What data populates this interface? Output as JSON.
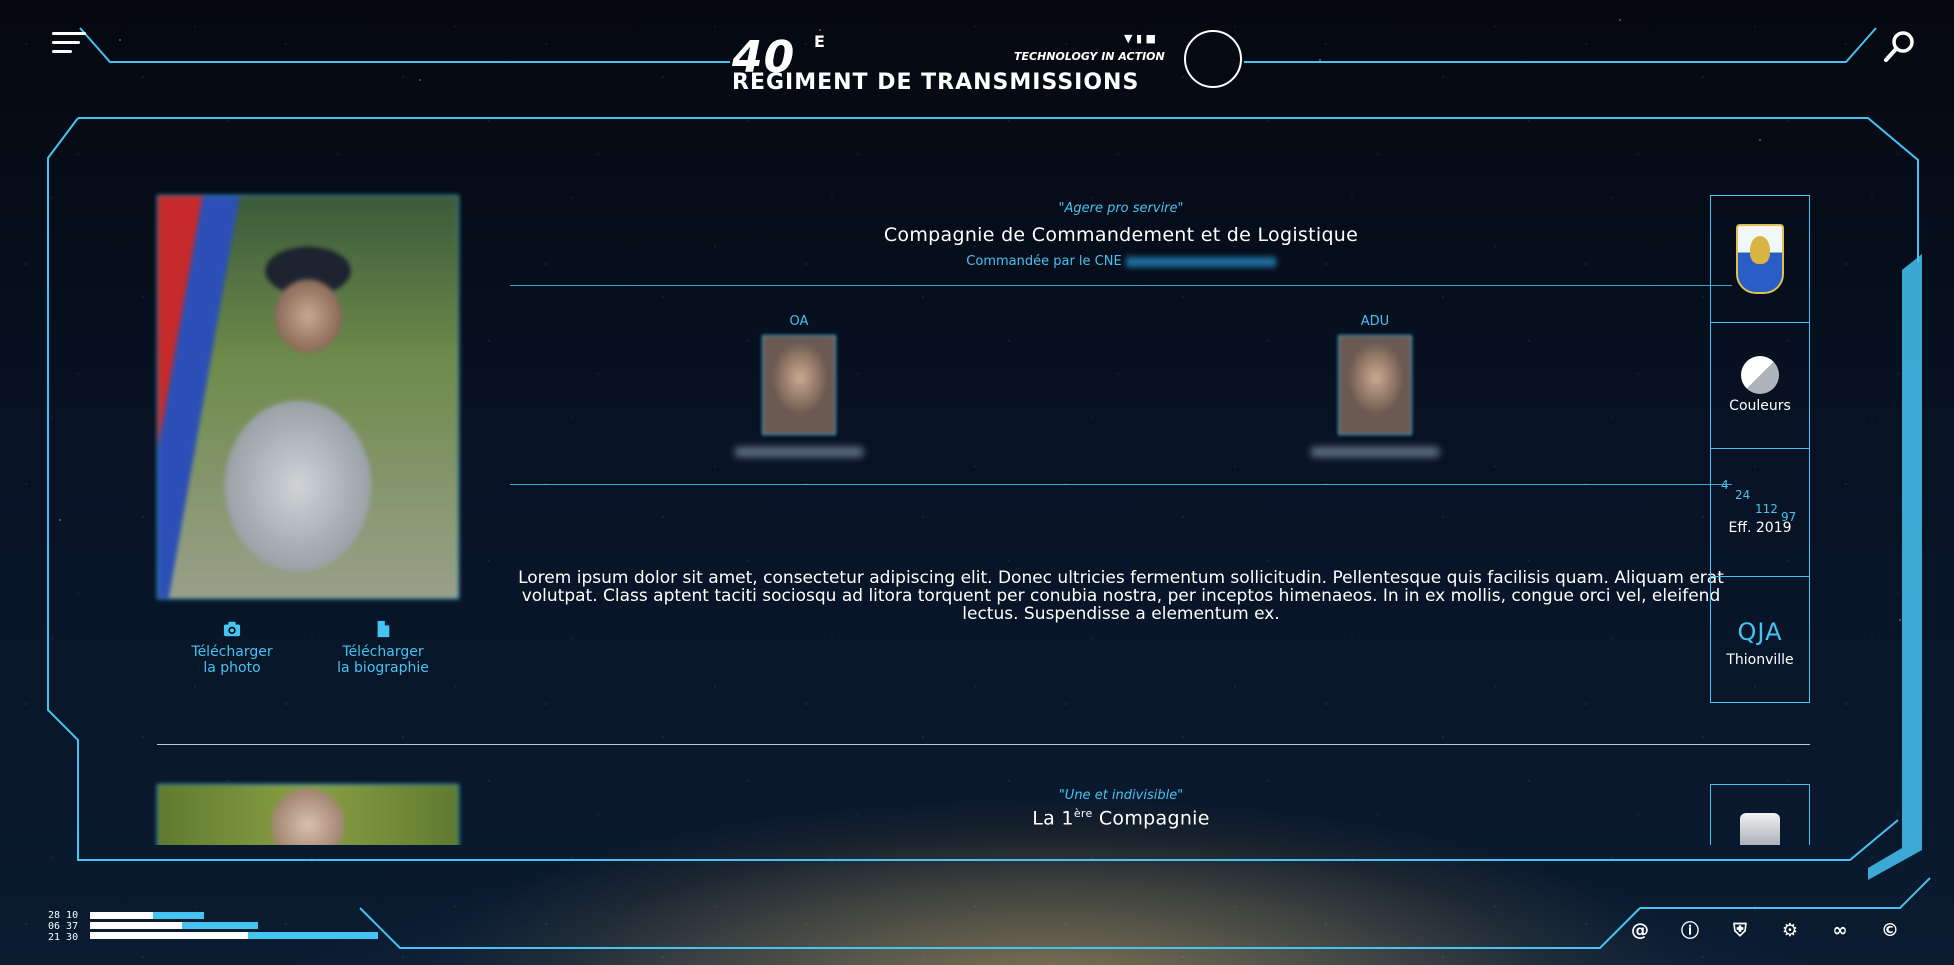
{
  "header": {
    "logo_number": "40",
    "logo_sup": "E",
    "logo_title": "REGIMENT DE TRANSMISSIONS",
    "logo_tagline": "TECHNOLOGY IN ACTION",
    "menu_icon": "menu-icon",
    "search_icon": "search-icon"
  },
  "card1": {
    "motto": "\"Agere pro servire\"",
    "title": "Compagnie de Commandement et de Logistique",
    "commanded_by": "Commandée par le CNE",
    "people": [
      {
        "role": "OA"
      },
      {
        "role": "ADU"
      }
    ],
    "description": "Lorem ipsum dolor sit amet, consectetur adipiscing elit. Donec ultricies fermentum sollicitudin. Pellentesque quis facilisis quam. Aliquam erat volutpat. Class aptent taciti sociosqu ad litora torquent per conubia nostra, per inceptos himenaeos. In in ex mollis, congue orci vel, eleifend lectus. Suspendisse a elementum ex.",
    "download_photo_line1": "Télécharger",
    "download_photo_line2": "la photo",
    "download_bio_line1": "Télécharger",
    "download_bio_line2": "la biographie",
    "side": {
      "colors_label": "Couleurs",
      "effectives": {
        "n1": "4",
        "n2": "24",
        "n3": "112",
        "n4": "97",
        "label": "Eff. 2019"
      },
      "location_code": "QJA",
      "location": "Thionville"
    }
  },
  "card2": {
    "motto": "\"Une et indivisible\"",
    "title_prefix": "La 1",
    "title_sup": "ère",
    "title_suffix": " Compagnie"
  },
  "footer": {
    "status_lines": [
      "28 10",
      "06 37",
      "21 30"
    ],
    "bars": [
      0.38,
      0.56,
      0.96
    ],
    "icons": [
      "at-icon",
      "info-icon",
      "shield-icon",
      "gear-icon",
      "link-icon",
      "copyright-icon"
    ],
    "icon_glyphs": [
      "@",
      "ⓘ",
      "⛨",
      "⚙",
      "∞",
      "©"
    ]
  },
  "colors": {
    "accent": "#45c3f2",
    "text": "#ffffff"
  }
}
